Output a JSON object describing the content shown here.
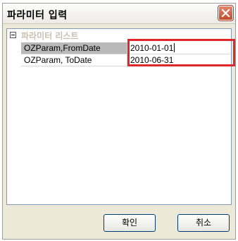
{
  "window": {
    "title": "파라미터 입력",
    "close_icon": "close-icon"
  },
  "tree": {
    "group_label": "파라미터 리스트",
    "rows": [
      {
        "name": "OZParam,FromDate",
        "value": "2010-01-01"
      },
      {
        "name": "OZParam, ToDate",
        "value": "2010-06-31"
      }
    ]
  },
  "buttons": {
    "ok_label": "확인",
    "cancel_label": "취소"
  },
  "colors": {
    "highlight": "#e0272a",
    "close_button": "#c24b2b"
  }
}
